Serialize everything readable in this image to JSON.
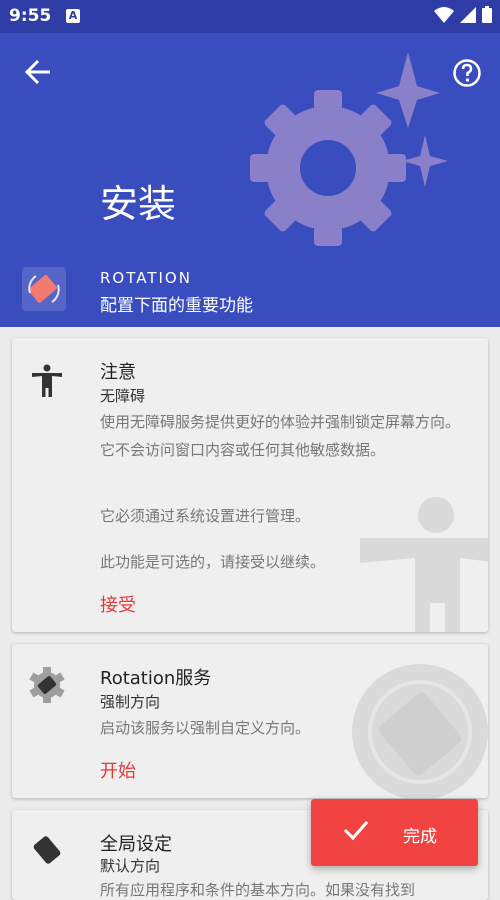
{
  "status": {
    "time": "9:55",
    "notif_icon_letter": "A"
  },
  "header": {
    "title": "安装",
    "app_name": "ROTATION",
    "subtitle": "配置下面的重要功能",
    "colors": {
      "bg": "#3A4DBF",
      "status_bg": "#2F3EA6",
      "deco": "#8A7FC9"
    }
  },
  "cards": [
    {
      "title": "注意",
      "subtitle": "无障碍",
      "description": "使用无障碍服务提供更好的体验并强制锁定屏幕方向。它不会访问窗口内容或任何其他敏感数据。",
      "note1": "它必须通过系统设置进行管理。",
      "note2": "此功能是可选的，请接受以继续。",
      "action": "接受",
      "icon": "accessibility-icon"
    },
    {
      "title": "Rotation服务",
      "subtitle": "强制方向",
      "description": "启动该服务以强制自定义方向。",
      "action": "开始",
      "icon": "rotation-service-icon"
    },
    {
      "title": "全局设定",
      "subtitle": "默认方向",
      "description": "所有应用程序和条件的基本方向。如果没有找到",
      "icon": "phone-rotate-icon"
    }
  ],
  "fab": {
    "label": "完成",
    "color": "#F24343"
  },
  "accent": "#E53935"
}
